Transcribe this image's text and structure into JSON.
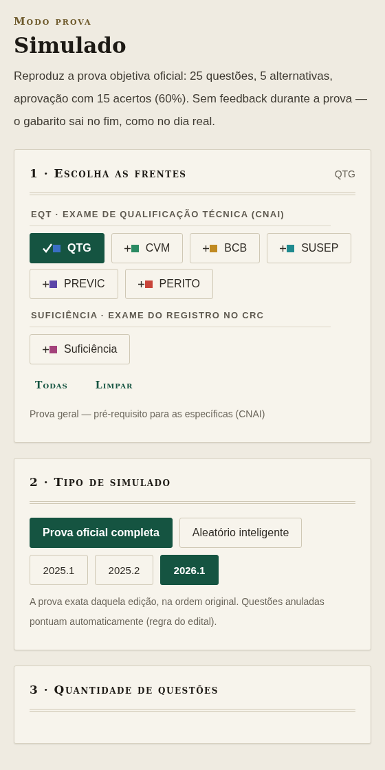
{
  "header": {
    "eyebrow": "Modo prova",
    "title": "Simulado",
    "description": "Reproduz a prova objetiva oficial: 25 questões, 5 alternativas, aprovação com 15 acertos (60%). Sem feedback durante a prova — o gabarito sai no fim, como no dia real."
  },
  "sections": [
    {
      "title": "1 · Escolha as frentes",
      "summary": "QTG",
      "groups": [
        {
          "label": "EQT · EXAME DE QUALIFICAÇÃO TÉCNICA (CNAI)",
          "chips": [
            {
              "label": "QTG",
              "color": "#3a6fc4",
              "selected": true
            },
            {
              "label": "CVM",
              "color": "#2a8a63",
              "selected": false
            },
            {
              "label": "BCB",
              "color": "#c08a22",
              "selected": false
            },
            {
              "label": "SUSEP",
              "color": "#1f8a8f",
              "selected": false
            },
            {
              "label": "PREVIC",
              "color": "#5b45a8",
              "selected": false
            },
            {
              "label": "PERITO",
              "color": "#c8443a",
              "selected": false
            }
          ]
        },
        {
          "label": "SUFICIÊNCIA · EXAME DO REGISTRO NO CRC",
          "chips": [
            {
              "label": "Suficiência",
              "color": "#a3417a",
              "selected": false
            }
          ]
        }
      ],
      "links": [
        "Todas",
        "Limpar"
      ],
      "note": "Prova geral — pré-requisito para as específicas (CNAI)"
    },
    {
      "title": "2 · Tipo de simulado",
      "options": [
        {
          "label": "Prova oficial completa",
          "selected": true
        },
        {
          "label": "Aleatório inteligente",
          "selected": false
        }
      ],
      "editions": [
        {
          "label": "2025.1",
          "selected": false
        },
        {
          "label": "2025.2",
          "selected": false
        },
        {
          "label": "2026.1",
          "selected": true
        }
      ],
      "note": "A prova exata daquela edição, na ordem original. Questões anuladas pontuam automaticamente (regra do edital)."
    },
    {
      "title": "3 · Quantidade de questões"
    }
  ]
}
